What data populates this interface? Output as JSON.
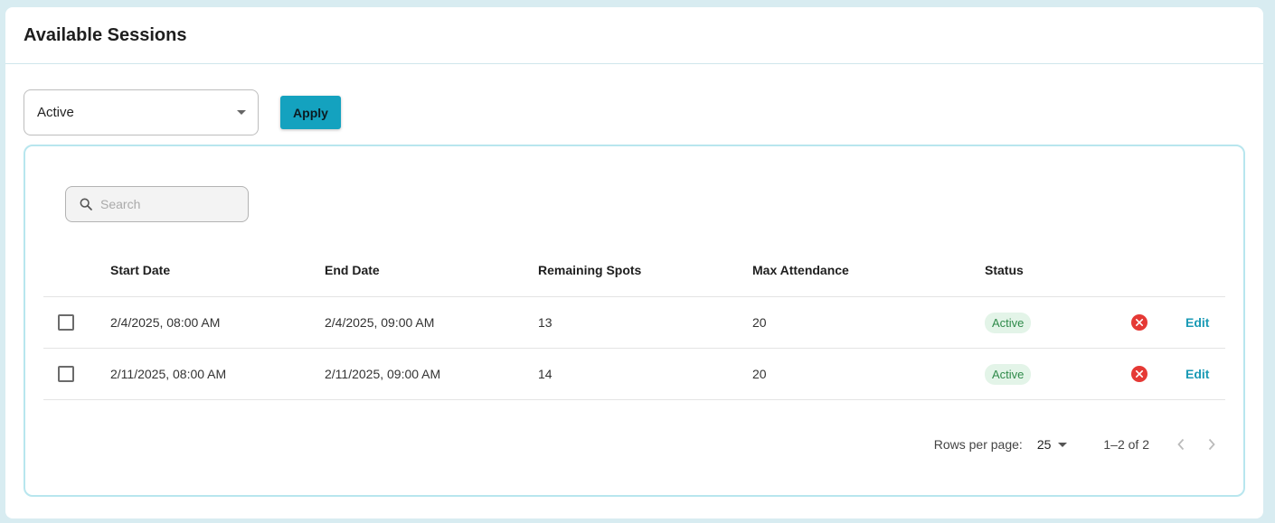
{
  "header": {
    "title": "Available Sessions"
  },
  "filter": {
    "selected": "Active",
    "apply_label": "Apply"
  },
  "search": {
    "placeholder": "Search",
    "value": ""
  },
  "table": {
    "columns": [
      "Start Date",
      "End Date",
      "Remaining Spots",
      "Max Attendance",
      "Status"
    ],
    "rows": [
      {
        "start": "2/4/2025, 08:00 AM",
        "end": "2/4/2025, 09:00 AM",
        "remaining": "13",
        "max": "20",
        "status": "Active",
        "edit_label": "Edit"
      },
      {
        "start": "2/11/2025, 08:00 AM",
        "end": "2/11/2025, 09:00 AM",
        "remaining": "14",
        "max": "20",
        "status": "Active",
        "edit_label": "Edit"
      }
    ]
  },
  "pagination": {
    "rows_per_page_label": "Rows per page:",
    "rows_per_page": "25",
    "range": "1–2 of 2"
  },
  "colors": {
    "accent": "#14a2bf",
    "active_badge_bg": "#e3f4e8",
    "active_badge_text": "#2f8a4a",
    "delete": "#e53935",
    "panel_border": "#b8e6ee"
  },
  "icons": {
    "search": "search-icon",
    "dropdown": "chevron-down-icon",
    "delete": "cancel-circle-icon",
    "prev": "chevron-left-icon",
    "next": "chevron-right-icon"
  }
}
